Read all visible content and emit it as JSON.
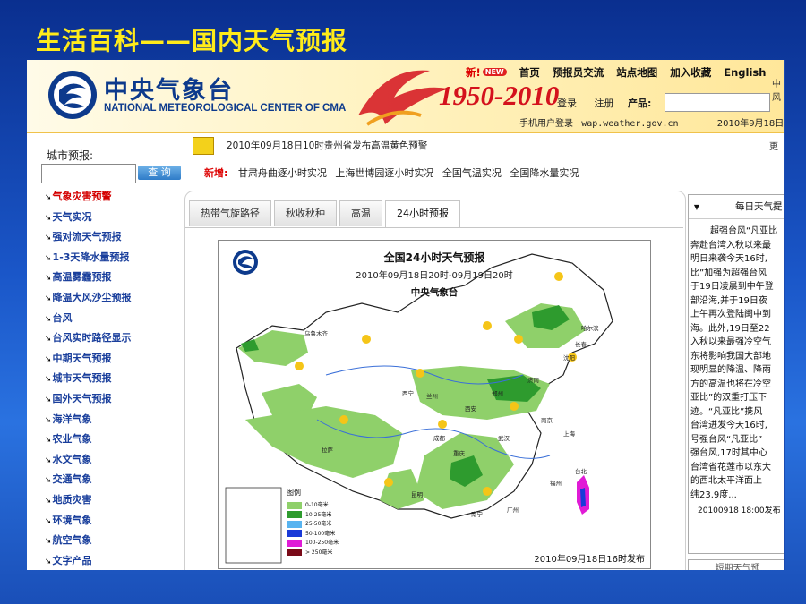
{
  "slide": {
    "title": "生活百科——国内天气预报"
  },
  "header": {
    "logo_cn": "中央气象台",
    "logo_en": "NATIONAL METEOROLOGICAL CENTER OF CMA",
    "anniversary": "1950-2010",
    "new_label": "新!",
    "new_pill": "NEW",
    "nav": [
      "首页",
      "预报员交流",
      "站点地图",
      "加入收藏",
      "English"
    ],
    "login": "登录",
    "register": "注册",
    "product_label": "产品:",
    "mobile_login": "手机用户登录",
    "mobile_url": "wap.weather.gov.cn",
    "date": "2010年9月18日",
    "right_cut": "中风"
  },
  "sidebar": {
    "city_label": "城市预报:",
    "query_button": "查 询",
    "menu": [
      "气象灾害预警",
      "天气实况",
      "强对流天气预报",
      "1-3天降水量预报",
      "高温雾霾预报",
      "降温大风沙尘预报",
      "台风",
      "台风实时路径显示",
      "中期天气预报",
      "城市天气预报",
      "国外天气预报",
      "海洋气象",
      "农业气象",
      "水文气象",
      "交通气象",
      "地质灾害",
      "环境气象",
      "航空气象",
      "文字产品"
    ],
    "active_index": 0
  },
  "alert": {
    "text": "2010年09月18日10时贵州省发布高温黄色预警",
    "more": "更"
  },
  "new_row": {
    "label": "新增:",
    "links": [
      "甘肃舟曲逐小时实况",
      "上海世博园逐小时实况",
      "全国气温实况",
      "全国降水量实况"
    ]
  },
  "tabs": [
    "热带气旋路径",
    "秋收秋种",
    "高温",
    "24小时预报"
  ],
  "active_tab": 3,
  "map": {
    "title": "全国24小时天气预报",
    "time_range": "2010年09月18日20时-09月19日20时",
    "agency": "中央气象台",
    "legend_title": "图例",
    "legend": [
      {
        "label": "0-10毫米",
        "color": "#8fd06a"
      },
      {
        "label": "10-25毫米",
        "color": "#2e9b2e"
      },
      {
        "label": "25-50毫米",
        "color": "#58b4f0"
      },
      {
        "label": "50-100毫米",
        "color": "#1a3ad8"
      },
      {
        "label": "100-250毫米",
        "color": "#e01bd6"
      },
      {
        "label": "> 250毫米",
        "color": "#7a0a18"
      }
    ],
    "cities": [
      "哈尔滨",
      "长春",
      "沈阳",
      "乌鲁木齐",
      "兰州",
      "西宁",
      "西安",
      "郑州",
      "济南",
      "成都",
      "拉萨",
      "武汉",
      "南京",
      "上海",
      "福州",
      "台北",
      "广州",
      "南宁",
      "昆明",
      "重庆"
    ],
    "issued": "2010年09月18日16时发布"
  },
  "right_panel": {
    "title": "每日天气提",
    "lines": [
      "超强台风“凡亚比",
      "奔赴台湾入秋以来最",
      "明日来袭今天16时,",
      "比”加强为超强台风",
      "于19日凌晨到中午登",
      "部沿海,并于19日夜",
      "上午再次登陆闽中到",
      "海。此外,19日至22",
      "入秋以来最强冷空气",
      "东将影响我国大部地",
      "现明显的降温、降雨",
      "方的高温也将在冷空",
      "亚比”的双重打压下",
      "迹。“凡亚比”携风",
      "台湾进发今天16时,",
      "号强台风“凡亚比”",
      "强台风,17时其中心",
      "台湾省花莲市以东大",
      "的西北太平洋面上",
      "纬23.9度..."
    ],
    "timestamp": "20100918 18:00发布",
    "footer": "短期天气预"
  }
}
